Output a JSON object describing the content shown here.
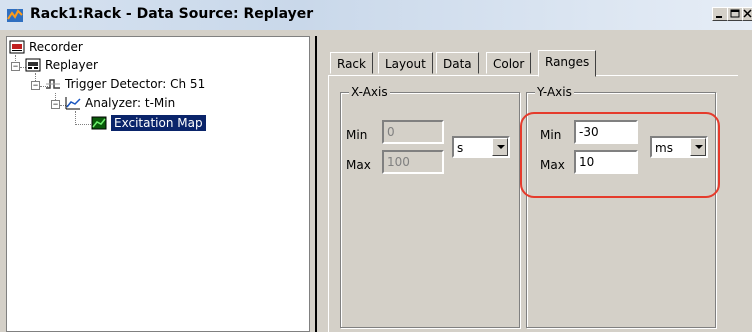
{
  "window": {
    "title": "Rack1:Rack - Data Source: Replayer"
  },
  "tree": {
    "items": [
      {
        "label": "Recorder",
        "icon": "recorder-icon"
      },
      {
        "label": "Replayer",
        "icon": "replayer-icon"
      },
      {
        "label": "Trigger Detector: Ch 51",
        "icon": "trigger-icon"
      },
      {
        "label": "Analyzer: t-Min",
        "icon": "analyzer-icon"
      },
      {
        "label": "Excitation Map",
        "icon": "map-icon",
        "selected": true
      }
    ]
  },
  "tabs": [
    "Rack",
    "Layout",
    "Data",
    "Color",
    "Ranges"
  ],
  "active_tab": "Ranges",
  "x_axis": {
    "title": "X-Axis",
    "min_label": "Min",
    "max_label": "Max",
    "min_value": "0",
    "max_value": "100",
    "unit": "s"
  },
  "y_axis": {
    "title": "Y-Axis",
    "min_label": "Min",
    "max_label": "Max",
    "min_value": "-30",
    "max_value": "10",
    "unit": "ms"
  },
  "colors": {
    "highlight": "#e53b2c",
    "selection": "#0a246a"
  }
}
